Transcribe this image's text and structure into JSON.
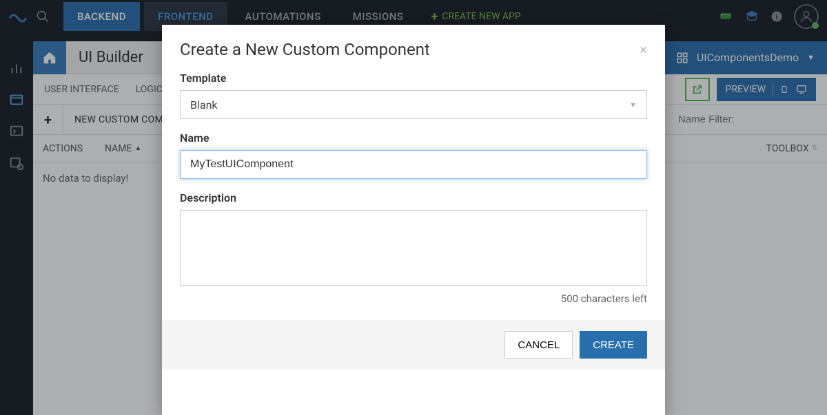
{
  "topbar": {
    "tabs": [
      "BACKEND",
      "FRONTEND",
      "AUTOMATIONS",
      "MISSIONS"
    ],
    "create_app": "CREATE NEW APP"
  },
  "subheader": {
    "page_title": "UI Builder",
    "app_name": "UIComponentsDemo"
  },
  "section_tabs": {
    "tab1": "USER INTERFACE",
    "tab2": "LOGIC",
    "preview_label": "PREVIEW"
  },
  "toolbar": {
    "new_label": "NEW CUSTOM COMPONENT",
    "name_filter_placeholder": "Name Filter:"
  },
  "table": {
    "col_actions": "ACTIONS",
    "col_name": "NAME",
    "col_toolbox": "TOOLBOX",
    "empty": "No data to display!"
  },
  "modal": {
    "title": "Create a New Custom Component",
    "template_label": "Template",
    "template_value": "Blank",
    "name_label": "Name",
    "name_value": "MyTestUIComponent",
    "description_label": "Description",
    "description_value": "",
    "char_count": "500 characters left",
    "cancel": "CANCEL",
    "create": "CREATE"
  }
}
